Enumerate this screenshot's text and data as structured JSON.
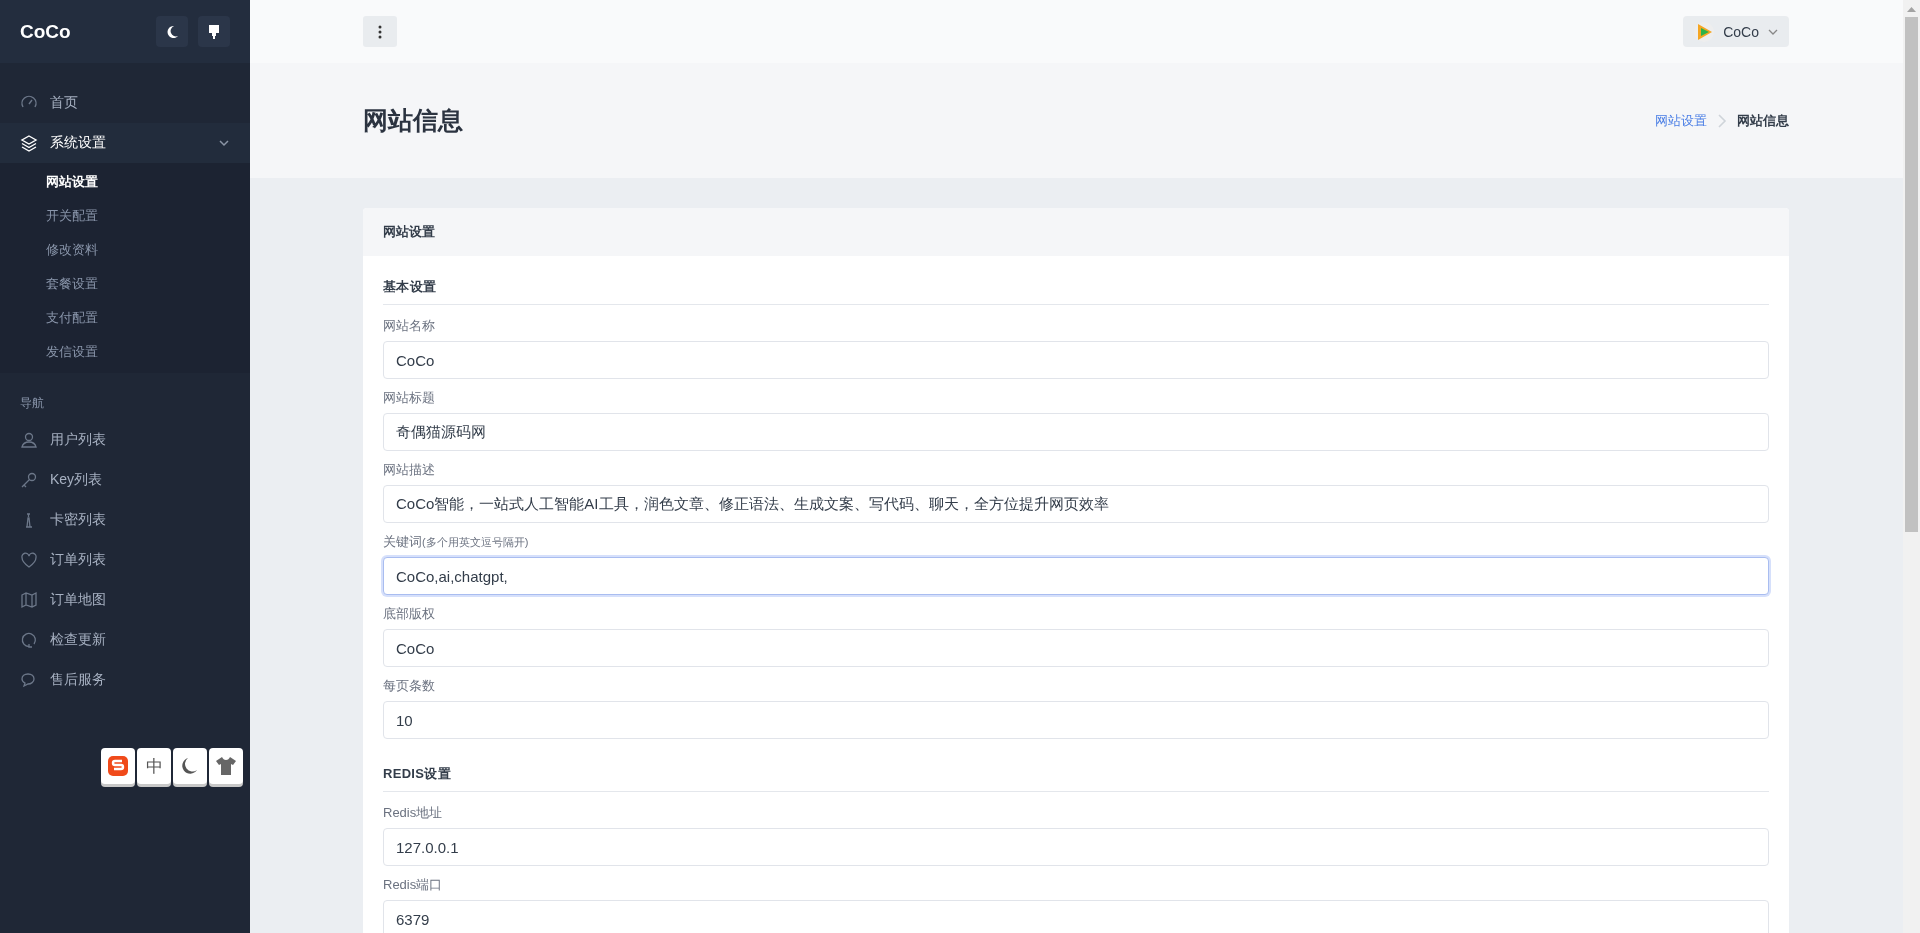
{
  "sidebar": {
    "brand": "CoCo",
    "items": [
      {
        "label": "首页",
        "selected": false
      },
      {
        "label": "系统设置",
        "selected": false,
        "expanded": true,
        "children": [
          {
            "label": "网站设置",
            "selected": true
          },
          {
            "label": "开关配置",
            "selected": false
          },
          {
            "label": "修改资料",
            "selected": false
          },
          {
            "label": "套餐设置",
            "selected": false
          },
          {
            "label": "支付配置",
            "selected": false
          },
          {
            "label": "发信设置",
            "selected": false
          }
        ]
      }
    ],
    "section_heading": "导航",
    "nav_items": [
      {
        "label": "用户列表",
        "selected": false
      },
      {
        "label": "Key列表",
        "selected": false
      },
      {
        "label": "卡密列表",
        "selected": false
      },
      {
        "label": "订单列表",
        "selected": false
      },
      {
        "label": "订单地图",
        "selected": false
      },
      {
        "label": "检查更新",
        "selected": false
      },
      {
        "label": "售后服务",
        "selected": false
      }
    ]
  },
  "ime_toolbar": {
    "keys": [
      {
        "kind": "logo"
      },
      {
        "kind": "text",
        "label": "中"
      },
      {
        "kind": "moon"
      },
      {
        "kind": "shirt"
      }
    ]
  },
  "header": {
    "user": "CoCo"
  },
  "page": {
    "title": "网站信息",
    "breadcrumb": [
      {
        "label": "网站设置",
        "kind": "link"
      },
      {
        "label": "网站信息",
        "kind": "current"
      }
    ]
  },
  "card": {
    "title": "网站设置",
    "items": [
      {
        "kind": "heading",
        "label": "基本设置"
      },
      {
        "kind": "field",
        "label": "网站名称",
        "value": "CoCo",
        "focused": false
      },
      {
        "kind": "field",
        "label": "网站标题",
        "value": "奇偶猫源码网",
        "focused": false
      },
      {
        "kind": "field",
        "label": "网站描述",
        "value": "CoCo智能，一站式人工智能AI工具，润色文章、修正语法、生成文案、写代码、聊天，全方位提升网页效率",
        "focused": false
      },
      {
        "kind": "field",
        "label": "关键词",
        "hint": "(多个用英文逗号隔开)",
        "value": "CoCo,ai,chatgpt,",
        "focused": true
      },
      {
        "kind": "field",
        "label": "底部版权",
        "value": "CoCo",
        "focused": false
      },
      {
        "kind": "field",
        "label": "每页条数",
        "value": "10",
        "focused": false
      },
      {
        "kind": "heading",
        "label": "REDIS设置"
      },
      {
        "kind": "field",
        "label": "Redis地址",
        "value": "127.0.0.1",
        "focused": false
      },
      {
        "kind": "field",
        "label": "Redis端口",
        "value": "6379",
        "focused": false
      }
    ]
  }
}
